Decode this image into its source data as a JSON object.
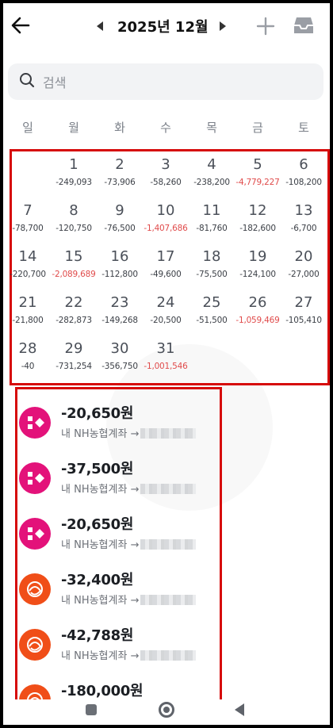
{
  "header": {
    "month_label": "2025년 12월",
    "back_icon": "back-arrow-icon",
    "prev_icon": "chevron-left-icon",
    "next_icon": "chevron-right-icon",
    "add_icon": "plus-icon",
    "inbox_icon": "inbox-icon"
  },
  "search": {
    "placeholder": "검색",
    "icon": "search-icon"
  },
  "weekdays": [
    "일",
    "월",
    "화",
    "수",
    "목",
    "금",
    "토"
  ],
  "calendar": {
    "days": [
      {
        "day": "1",
        "amount": "-249,093",
        "highlight": false
      },
      {
        "day": "2",
        "amount": "-73,906",
        "highlight": false
      },
      {
        "day": "3",
        "amount": "-58,260",
        "highlight": false
      },
      {
        "day": "4",
        "amount": "-238,200",
        "highlight": false
      },
      {
        "day": "5",
        "amount": "-4,779,227",
        "highlight": true
      },
      {
        "day": "6",
        "amount": "-108,200",
        "highlight": false
      },
      {
        "day": "7",
        "amount": "-78,700",
        "highlight": false
      },
      {
        "day": "8",
        "amount": "-120,750",
        "highlight": false
      },
      {
        "day": "9",
        "amount": "-76,500",
        "highlight": false
      },
      {
        "day": "10",
        "amount": "-1,407,686",
        "highlight": true
      },
      {
        "day": "11",
        "amount": "-81,760",
        "highlight": false
      },
      {
        "day": "12",
        "amount": "-182,600",
        "highlight": false
      },
      {
        "day": "13",
        "amount": "-6,700",
        "highlight": false
      },
      {
        "day": "14",
        "amount": "-220,700",
        "highlight": false
      },
      {
        "day": "15",
        "amount": "-2,089,689",
        "highlight": true
      },
      {
        "day": "16",
        "amount": "-112,800",
        "highlight": false
      },
      {
        "day": "17",
        "amount": "-49,600",
        "highlight": false
      },
      {
        "day": "18",
        "amount": "-75,500",
        "highlight": false
      },
      {
        "day": "19",
        "amount": "-124,100",
        "highlight": false
      },
      {
        "day": "20",
        "amount": "-27,000",
        "highlight": false
      },
      {
        "day": "21",
        "amount": "-21,800",
        "highlight": false
      },
      {
        "day": "22",
        "amount": "-282,873",
        "highlight": false
      },
      {
        "day": "23",
        "amount": "-149,268",
        "highlight": false
      },
      {
        "day": "24",
        "amount": "-20,500",
        "highlight": false
      },
      {
        "day": "25",
        "amount": "-51,500",
        "highlight": false
      },
      {
        "day": "26",
        "amount": "-1,059,469",
        "highlight": true
      },
      {
        "day": "27",
        "amount": "-105,410",
        "highlight": false
      },
      {
        "day": "28",
        "amount": "-40",
        "highlight": false
      },
      {
        "day": "29",
        "amount": "-731,254",
        "highlight": false
      },
      {
        "day": "30",
        "amount": "-356,750",
        "highlight": false
      },
      {
        "day": "31",
        "amount": "-1,001,546",
        "highlight": true
      }
    ],
    "first_weekday_index": 1
  },
  "transactions": [
    {
      "amount": "-20,650원",
      "desc": "내 NH농협계좌 →",
      "icon": "toss-pink-icon",
      "color": "#e3127a"
    },
    {
      "amount": "-37,500원",
      "desc": "내 NH농협계좌 →",
      "icon": "toss-pink-icon",
      "color": "#e3127a"
    },
    {
      "amount": "-20,650원",
      "desc": "내 NH농협계좌 →",
      "icon": "toss-pink-icon",
      "color": "#e3127a"
    },
    {
      "amount": "-32,400원",
      "desc": "내 NH농협계좌 →",
      "icon": "orange-swirl-icon",
      "color": "#f04e18"
    },
    {
      "amount": "-42,788원",
      "desc": "내 NH농협계좌 →",
      "icon": "orange-swirl-icon",
      "color": "#f04e18"
    },
    {
      "amount": "-180,000원",
      "desc": "",
      "icon": "orange-swirl-icon",
      "color": "#f04e18"
    }
  ],
  "colors": {
    "accent_red": "#e04b4b",
    "highlight_box": "#d60a0a"
  }
}
